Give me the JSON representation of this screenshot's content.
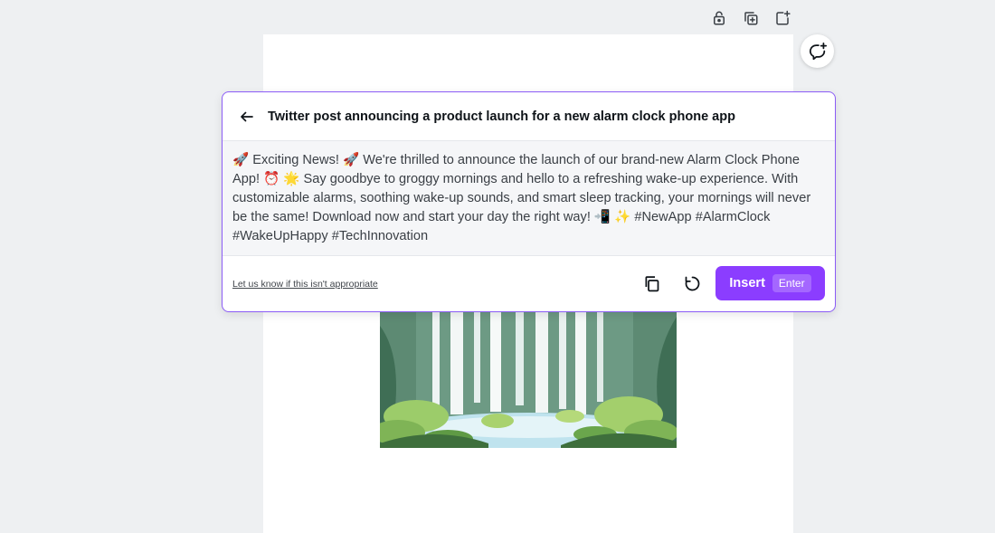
{
  "toolbar": {
    "icons": [
      "lock-icon",
      "duplicate-page-icon",
      "add-page-icon"
    ]
  },
  "comment": {
    "icon": "add-comment-icon"
  },
  "ai_panel": {
    "prompt": "Twitter post announcing a product launch for a new alarm clock phone app",
    "result_text": "🚀 Exciting News! 🚀 We're thrilled to announce the launch of our brand-new Alarm Clock Phone App! ⏰ 🌟 Say goodbye to groggy mornings and hello to a refreshing wake-up experience. With customizable alarms, soothing wake-up sounds, and smart sleep tracking, your mornings will never be the same! Download now and start your day the right way! 📲 ✨ #NewApp #AlarmClock #WakeUpHappy #TechInnovation",
    "feedback_link": "Let us know if this isn't appropriate",
    "insert_label": "Insert",
    "insert_shortcut": "Enter"
  },
  "colors": {
    "accent": "#8b3dff",
    "panel_border": "#8b5cf6",
    "canvas_bg": "#eef0f2",
    "result_bg": "#f5f6f8"
  }
}
